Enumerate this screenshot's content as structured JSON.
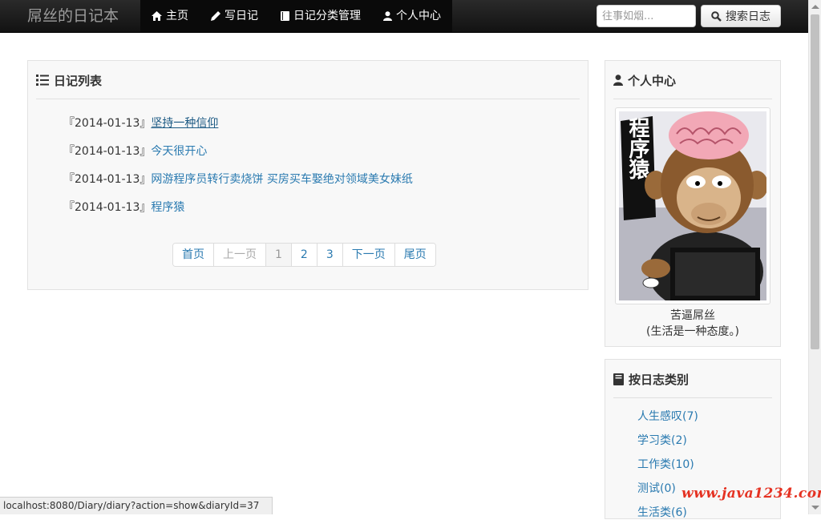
{
  "navbar": {
    "brand": "屌丝的日记本",
    "items": [
      {
        "label": "主页",
        "icon": "home-icon"
      },
      {
        "label": "写日记",
        "icon": "pencil-icon"
      },
      {
        "label": "日记分类管理",
        "icon": "book-icon"
      },
      {
        "label": "个人中心",
        "icon": "user-icon"
      }
    ],
    "search": {
      "placeholder": "往事如烟...",
      "value": "",
      "button_label": "搜索日志"
    }
  },
  "diary_panel": {
    "title": "日记列表",
    "items": [
      {
        "date": "『2014-01-13』",
        "title": "坚持一种信仰"
      },
      {
        "date": "『2014-01-13』",
        "title": "今天很开心"
      },
      {
        "date": "『2014-01-13』",
        "title": "网游程序员转行卖烧饼 买房买车娶绝对领域美女妹纸"
      },
      {
        "date": "『2014-01-13』",
        "title": "程序猿"
      }
    ],
    "pagination": {
      "first": "首页",
      "prev": "上一页",
      "pages": [
        "1",
        "2",
        "3"
      ],
      "current": "1",
      "next": "下一页",
      "last": "尾页"
    }
  },
  "profile_panel": {
    "title": "个人中心",
    "avatar_caption": "程序猿",
    "name": "苦逼屌丝",
    "motto": "(生活是一种态度。)"
  },
  "category_panel": {
    "title": "按日志类别",
    "items": [
      "人生感叹(7)",
      "学习类(2)",
      "工作类(10)",
      "测试(0)",
      "生活类(6)"
    ]
  },
  "statusbar": {
    "url": "localhost:8080/Diary/diary?action=show&diaryId=37"
  },
  "watermark": "www.java1234.com",
  "colors": {
    "link": "#2a7ab0",
    "navbar": "#1b1b1b",
    "watermark": "#e53222"
  }
}
